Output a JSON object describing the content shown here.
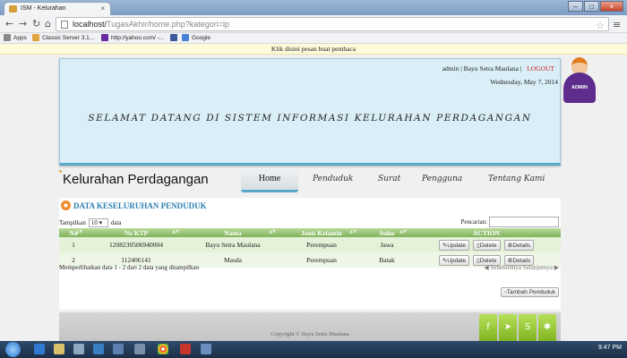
{
  "browser": {
    "tab_title": "ISM - Kelurahan",
    "tab_close": "×",
    "url_host": "localhost/",
    "url_path": "TugasAkhir/home.php?kategori=lp",
    "bookmarks": [
      "Apps",
      "Classic Server 3.1...",
      "http://yahoo.com/ -...",
      "Google"
    ]
  },
  "notice": "Klik disini pesan buat pembaca",
  "header": {
    "user": "admin | Bayu Setra Maulana |",
    "logout": "LOGOUT",
    "date": "Wednesday, May 7, 2014",
    "welcome": "SELAMAT DATANG DI SISTEM INFORMASI KELURAHAN PERDAGANGAN",
    "avatar_label": "ADMIN"
  },
  "site": {
    "title": "Kelurahan Perdagangan",
    "nav": [
      "Home",
      "Penduduk",
      "Surat",
      "Pengguna",
      "Tentang Kami"
    ]
  },
  "section": {
    "title": "DATA KESELURUHAN PENDUDUK",
    "show_prefix": "Tampilkan",
    "show_value": "10",
    "show_suffix": "data",
    "search_label": "Pencarian:"
  },
  "table": {
    "headers": [
      "No",
      "No KTP",
      "Nama",
      "Jenis Kelamin",
      "Suku",
      "ACTION"
    ],
    "rows": [
      [
        "1",
        "1208230506940004",
        "Bayu Setra Maulana",
        "Perempuan",
        "Jawa"
      ],
      [
        "2",
        "112406141",
        "Masda",
        "Perempuan",
        "Batak"
      ]
    ],
    "btn_update": "Update",
    "btn_delete": "Delete",
    "btn_detail": "Details"
  },
  "info": "Memperlihatkan data 1 - 2 dari 2 data yang ditampilkan",
  "pager": {
    "prev": "Sebelumnya",
    "next": "Selanjutnya"
  },
  "add_button": "Tambah Penduduk",
  "footer": "Copyright © Bayu Setra Maulana",
  "taskbar": {
    "time": "9:47 PM"
  }
}
